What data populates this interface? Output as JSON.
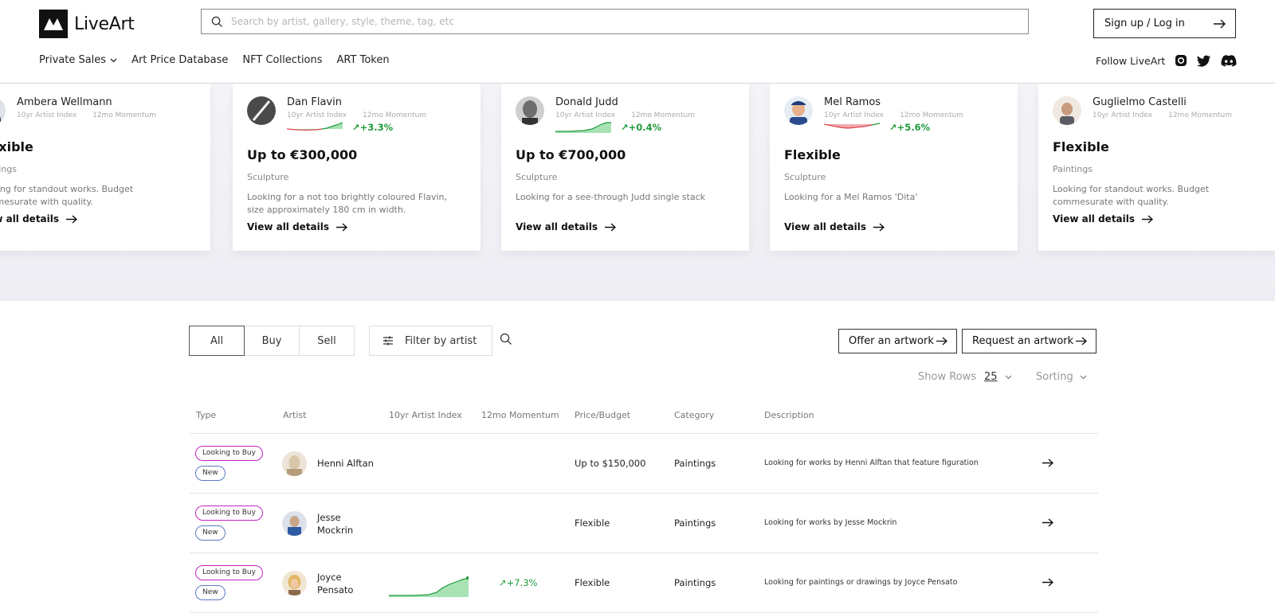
{
  "header": {
    "logo_text": "LiveArt",
    "search_placeholder": "Search by artist, gallery, style, theme, tag, etc",
    "signup_label": "Sign up / Log in",
    "nav": [
      "Private Sales",
      "Art Price Database",
      "NFT Collections",
      "ART Token"
    ],
    "follow_label": "Follow LiveArt",
    "social_icons": [
      "instagram-icon",
      "twitter-icon",
      "discord-icon"
    ]
  },
  "carousel": {
    "index_label": "10yr Artist Index",
    "momentum_label": "12mo Momentum",
    "view_label": "View all details",
    "cards": [
      {
        "artist": "Ambera Wellmann",
        "momentum": "",
        "trend": "none",
        "price": "Flexible",
        "category": "Paintings",
        "description": "Looking for standout works. Budget commesurate with quality."
      },
      {
        "artist": "Dan Flavin",
        "momentum": "+3.3%",
        "trend": "up",
        "price": "Up to €300,000",
        "category": "Sculpture",
        "description": "Looking for a not too brightly coloured Flavin, size approximately 180 cm in width."
      },
      {
        "artist": "Donald Judd",
        "momentum": "+0.4%",
        "trend": "up",
        "price": "Up to €700,000",
        "category": "Sculpture",
        "description": "Looking for a see-through Judd single stack"
      },
      {
        "artist": "Mel Ramos",
        "momentum": "+5.6%",
        "trend": "down",
        "price": "Flexible",
        "category": "Sculpture",
        "description": "Looking for a Mel Ramos 'Dita'"
      },
      {
        "artist": "Guglielmo Castelli",
        "momentum": "",
        "trend": "none",
        "price": "Flexible",
        "category": "Paintings",
        "description": "Looking for standout works. Budget commesurate with quality."
      }
    ]
  },
  "controls": {
    "segments": [
      "All",
      "Buy",
      "Sell"
    ],
    "active_segment": "All",
    "filter_label": "Filter by artist",
    "offer_label": "Offer an artwork",
    "request_label": "Request an artwork",
    "show_rows_label": "Show Rows",
    "rows_value": "25",
    "sorting_label": "Sorting"
  },
  "table": {
    "headers": [
      "Type",
      "Artist",
      "10yr Artist Index",
      "12mo Momentum",
      "Price/Budget",
      "Category",
      "Description"
    ],
    "rows": [
      {
        "tags": [
          "Looking to Buy",
          "New"
        ],
        "artist_line1": "Henni Alftan",
        "artist_line2": "",
        "momentum": "",
        "has_chart": false,
        "price": "Up to $150,000",
        "category": "Paintings",
        "description": "Looking for works by Henni Alftan that feature figuration"
      },
      {
        "tags": [
          "Looking to Buy",
          "New"
        ],
        "artist_line1": "Jesse",
        "artist_line2": "Mockrin",
        "momentum": "",
        "has_chart": false,
        "price": "Flexible",
        "category": "Paintings",
        "description": "Looking for works by Jesse Mockrin"
      },
      {
        "tags": [
          "Looking to Buy",
          "New"
        ],
        "artist_line1": "Joyce",
        "artist_line2": "Pensato",
        "momentum": "↗+7.3%",
        "has_chart": true,
        "price": "Flexible",
        "category": "Paintings",
        "description": "Looking for paintings or drawings by Joyce Pensato"
      }
    ]
  },
  "colors": {
    "accent_green": "#1f9b3a",
    "accent_red": "#d9474f",
    "tag_buy": "#c026c0",
    "tag_new": "#5b79c4"
  }
}
